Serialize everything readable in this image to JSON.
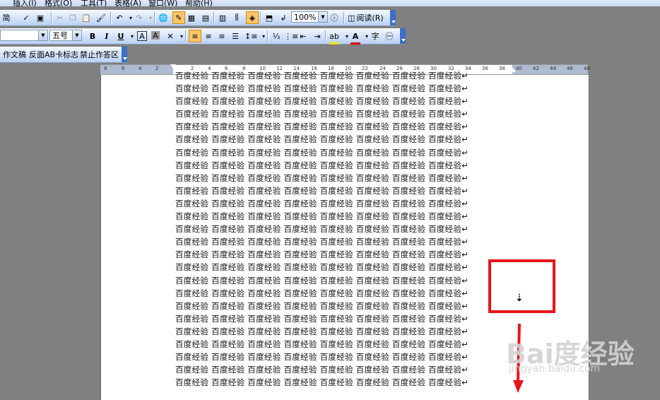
{
  "menubar": {
    "items": [
      "插入(I)",
      "格式(O)",
      "工具(T)",
      "表格(A)",
      "窗口(W)",
      "帮助(H)"
    ]
  },
  "toolbar1": {
    "jian": "简",
    "zoom": "100%",
    "read_label": "阅读(R)"
  },
  "toolbar2": {
    "font_size": "五号",
    "bold": "B",
    "italic": "I",
    "underline": "U",
    "font_color_glyph": "A"
  },
  "toolbar3": {
    "items": [
      "作文稿",
      "反面AB卡标志",
      "禁止作答区"
    ]
  },
  "ruler": {
    "ticks": [
      "8",
      "6",
      "4",
      "2",
      "2",
      "4",
      "6",
      "8",
      "10",
      "12",
      "14",
      "16",
      "18",
      "20",
      "22",
      "24",
      "26",
      "28",
      "30",
      "32",
      "34",
      "36",
      "38",
      "40",
      "42",
      "44",
      "46",
      "48"
    ]
  },
  "document": {
    "line_text": "百度经验 百度经验 百度经验 百度经验 百度经验 百度经验 百度经验 百度经验↵",
    "line_count": 25
  },
  "watermark": {
    "logo": "Bai度经验",
    "url": "jingyan.baidu.com"
  },
  "colors": {
    "highlight_border": "#e8141b",
    "toolbar_blue": "#3b6fc9",
    "workspace": "#808080"
  }
}
